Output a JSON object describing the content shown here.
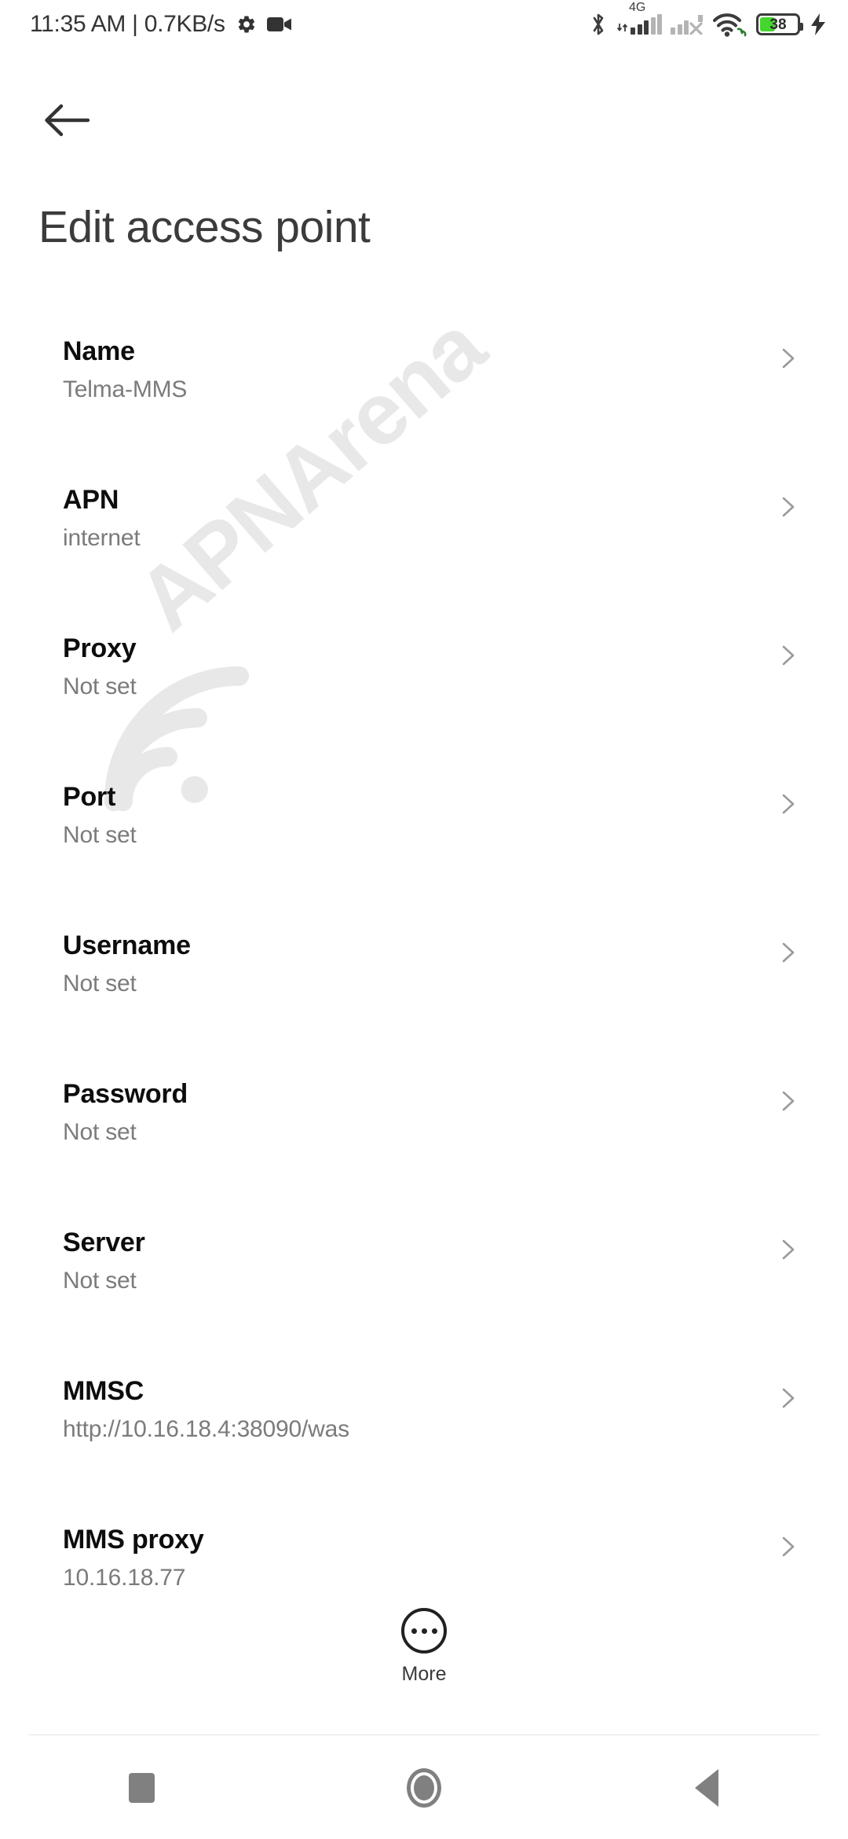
{
  "statusbar": {
    "clock": "11:35 AM | 0.7KB/s",
    "left_icons": [
      "gear-icon",
      "video-camera-icon"
    ],
    "right_icons": [
      "bluetooth-icon",
      "signal-4g-icon",
      "signal-sim2-off-icon",
      "wifi-link-icon",
      "battery-icon",
      "charging-bolt-icon"
    ],
    "network_type": "4G",
    "battery_percent": "38",
    "battery_color": "#44d62c"
  },
  "header": {
    "back_icon": "arrow-left-icon",
    "title": "Edit access point"
  },
  "watermark": {
    "text": "APNArena",
    "color": "#e8e8e8"
  },
  "list": {
    "chevron_icon": "chevron-right-icon",
    "items": [
      {
        "title": "Name",
        "value": "Telma-MMS"
      },
      {
        "title": "APN",
        "value": "internet"
      },
      {
        "title": "Proxy",
        "value": "Not set"
      },
      {
        "title": "Port",
        "value": "Not set"
      },
      {
        "title": "Username",
        "value": "Not set"
      },
      {
        "title": "Password",
        "value": "Not set"
      },
      {
        "title": "Server",
        "value": "Not set"
      },
      {
        "title": "MMSC",
        "value": "http://10.16.18.4:38090/was"
      },
      {
        "title": "MMS proxy",
        "value": "10.16.18.77"
      }
    ]
  },
  "more": {
    "icon": "more-dots-circle-icon",
    "label": "More"
  },
  "navbar": {
    "recents_icon": "square-recents-icon",
    "home_icon": "circle-home-icon",
    "back_icon": "triangle-back-icon"
  }
}
